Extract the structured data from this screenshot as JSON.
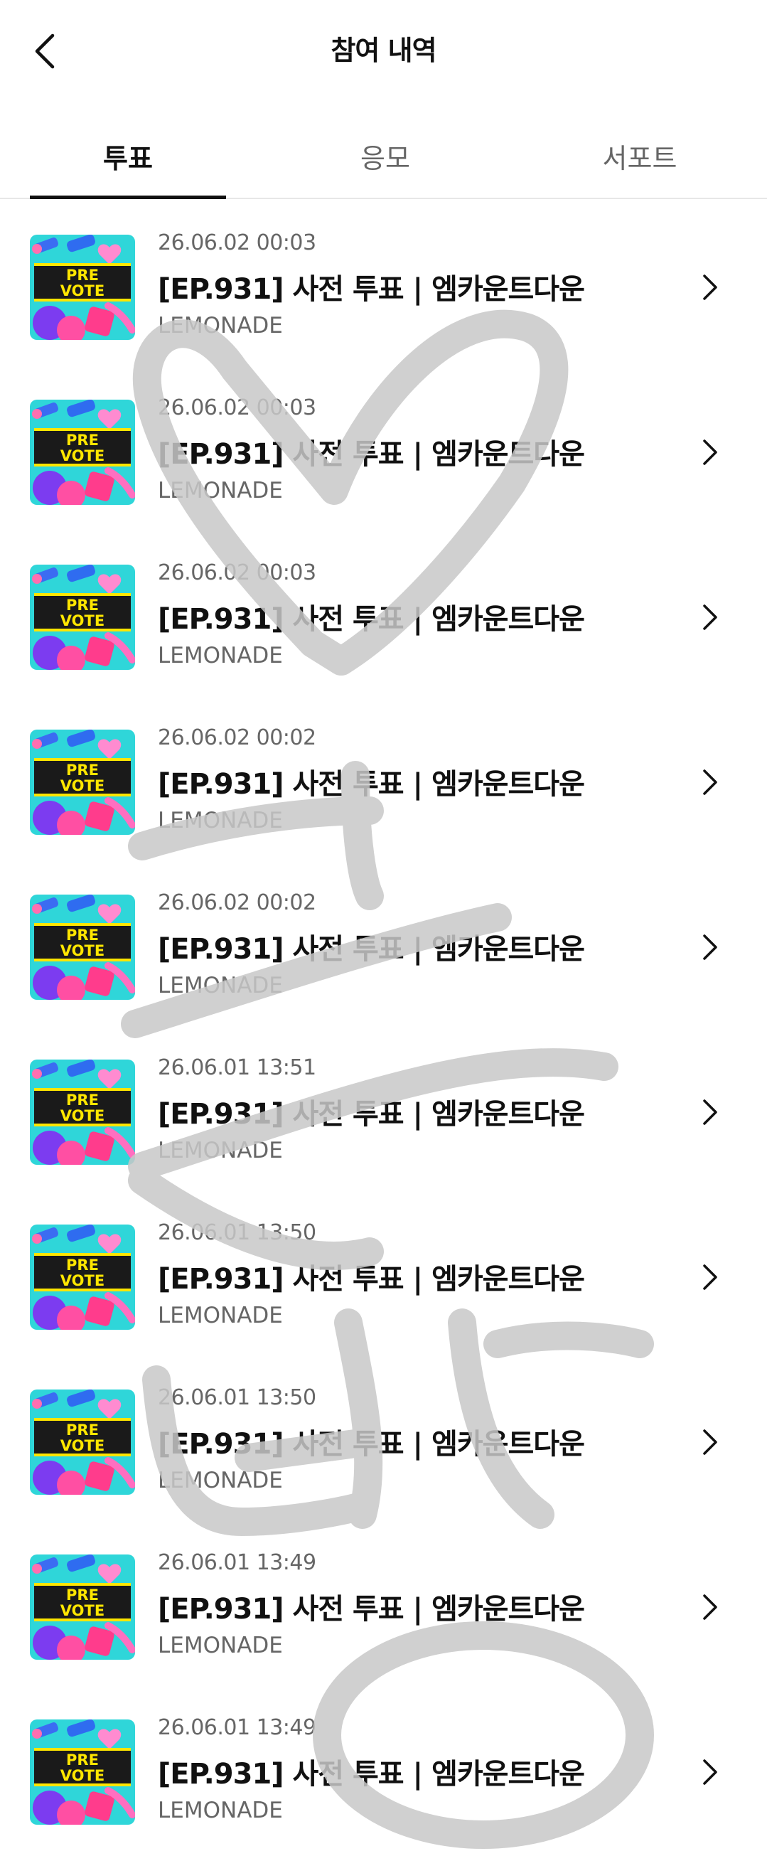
{
  "header": {
    "title": "참여 내역",
    "back_icon": "chevron-left-icon"
  },
  "tabs": [
    {
      "label": "투표",
      "active": true
    },
    {
      "label": "응모",
      "active": false
    },
    {
      "label": "서포트",
      "active": false
    }
  ],
  "thumbnail": {
    "line1": "PRE",
    "line2": "VOTE"
  },
  "items": [
    {
      "date": "26.06.02 00:03",
      "title": "[EP.931] 사전 투표 | 엠카운트다운",
      "artist": "LEMONADE"
    },
    {
      "date": "26.06.02 00:03",
      "title": "[EP.931] 사전 투표 | 엠카운트다운",
      "artist": "LEMONADE"
    },
    {
      "date": "26.06.02 00:03",
      "title": "[EP.931] 사전 투표 | 엠카운트다운",
      "artist": "LEMONADE"
    },
    {
      "date": "26.06.02 00:02",
      "title": "[EP.931] 사전 투표 | 엠카운트다운",
      "artist": "LEMONADE"
    },
    {
      "date": "26.06.02 00:02",
      "title": "[EP.931] 사전 투표 | 엠카운트다운",
      "artist": "LEMONADE"
    },
    {
      "date": "26.06.01 13:51",
      "title": "[EP.931] 사전 투표 | 엠카운트다운",
      "artist": "LEMONADE"
    },
    {
      "date": "26.06.01 13:50",
      "title": "[EP.931] 사전 투표 | 엠카운트다운",
      "artist": "LEMONADE"
    },
    {
      "date": "26.06.01 13:50",
      "title": "[EP.931] 사전 투표 | 엠카운트다운",
      "artist": "LEMONADE"
    },
    {
      "date": "26.06.01 13:49",
      "title": "[EP.931] 사전 투표 | 엠카운트다운",
      "artist": "LEMONADE"
    },
    {
      "date": "26.06.01 13:49",
      "title": "[EP.931] 사전 투표 | 엠카운트다운",
      "artist": "LEMONADE"
    }
  ],
  "colors": {
    "text_primary": "#111111",
    "text_secondary": "#666666",
    "tab_indicator": "#111111",
    "divider": "#e7e7e7",
    "overlay_scribble": "#c8c8c8",
    "thumb_bg": "#2fd6d9",
    "thumb_banner": "#1a1a1a",
    "thumb_banner_text": "#ffe600"
  }
}
